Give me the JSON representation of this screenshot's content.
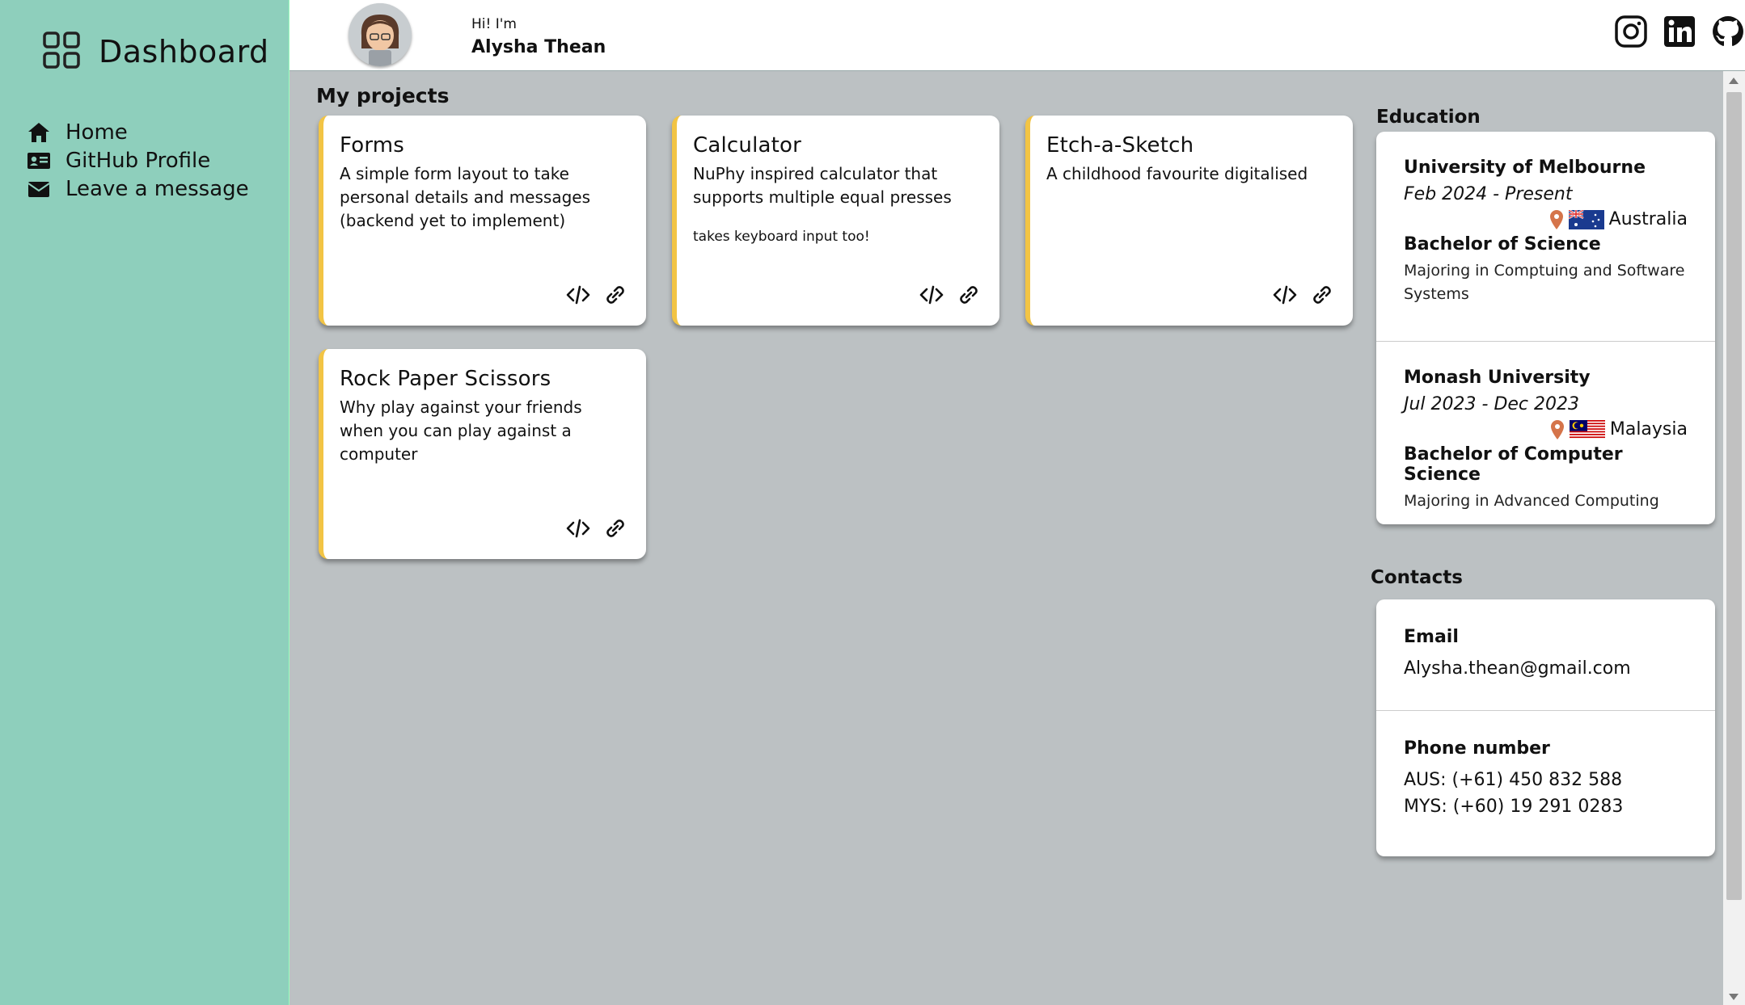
{
  "sidebar": {
    "brand": "Dashboard",
    "items": [
      {
        "label": "Home",
        "icon": "home-icon"
      },
      {
        "label": "GitHub Profile",
        "icon": "id-card-icon"
      },
      {
        "label": "Leave a message",
        "icon": "envelope-icon"
      }
    ]
  },
  "header": {
    "greeting": "Hi! I'm",
    "name": "Alysha Thean",
    "socials": [
      "instagram-icon",
      "linkedin-icon",
      "github-icon"
    ]
  },
  "projects": {
    "title": "My projects",
    "items": [
      {
        "title": "Forms",
        "desc": "A simple form layout to take personal details and messages (backend yet to implement)",
        "note": ""
      },
      {
        "title": "Calculator",
        "desc": "NuPhy inspired calculator that supports multiple equal presses",
        "note": "takes keyboard input too!"
      },
      {
        "title": "Etch-a-Sketch",
        "desc": "A childhood favourite digitalised",
        "note": ""
      },
      {
        "title": "Rock Paper Scissors",
        "desc": "Why play against your friends when you can play against a computer",
        "note": ""
      }
    ]
  },
  "education": {
    "title": "Education",
    "items": [
      {
        "school": "University of Melbourne",
        "dates": "Feb 2024 - Present",
        "country": "Australia",
        "degree": "Bachelor of Science",
        "major": "Majoring in Comptuing and Software Systems"
      },
      {
        "school": "Monash University",
        "dates": "Jul 2023 - Dec 2023",
        "country": "Malaysia",
        "degree": "Bachelor of Computer Science",
        "major": "Majoring in Advanced Computing"
      }
    ]
  },
  "contacts": {
    "title": "Contacts",
    "email_label": "Email",
    "email": "Alysha.thean@gmail.com",
    "phone_label": "Phone number",
    "phone_aus": "AUS: (+61) 450 832 588",
    "phone_mys": "MYS: (+60) 19 291 0283"
  },
  "colors": {
    "sidebar": "#8ecfbc",
    "card_accent": "#f2c444",
    "background": "#bcc1c3",
    "pin": "#d5744a"
  }
}
